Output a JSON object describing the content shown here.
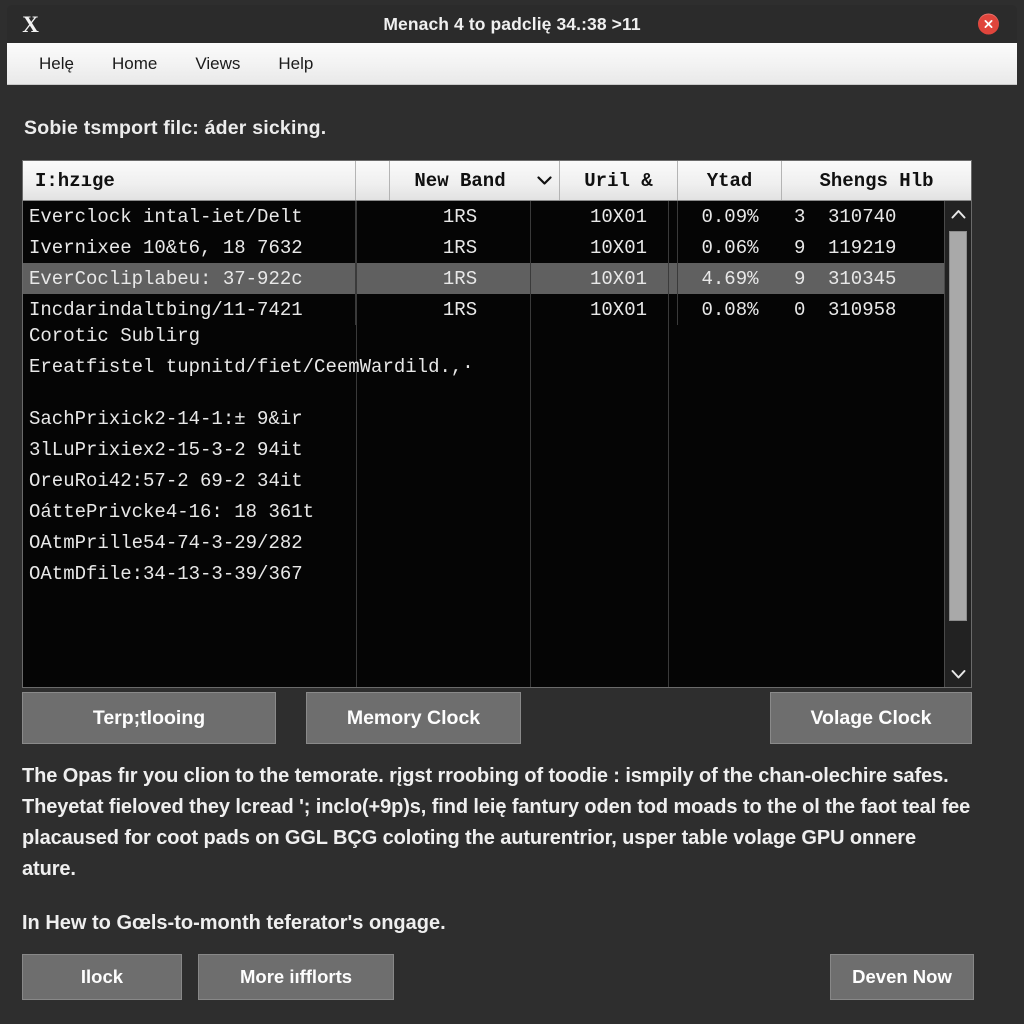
{
  "window": {
    "icon": "x-logo-icon",
    "title": "Menach 4 to padclię 34.:38 >11",
    "close_label": "close-icon"
  },
  "menubar": {
    "items": [
      {
        "label": "Helę"
      },
      {
        "label": "Home"
      },
      {
        "label": "Views"
      },
      {
        "label": "Help"
      }
    ]
  },
  "subtitle": "Sobie tsmport filc: áder sicking.",
  "table": {
    "headers": [
      {
        "label": "I:hzıge"
      },
      {
        "label": ""
      },
      {
        "label": "New Band"
      },
      {
        "label": "chevron-down-icon"
      },
      {
        "label": "Uril &"
      },
      {
        "label": "Ytad"
      },
      {
        "label": "Shengs Hlb"
      }
    ],
    "rows": [
      {
        "name": "Everclock intal-iet/Delt",
        "band": "1RS",
        "uril": "10X01",
        "ytad": "0.09%",
        "shengs_a": "3",
        "shengs_b": "310740",
        "selected": false
      },
      {
        "name": "Ivernixee 10&t6, 18 7632",
        "band": "1RS",
        "uril": "10X01",
        "ytad": "0.06%",
        "shengs_a": "9",
        "shengs_b": "119219",
        "selected": false
      },
      {
        "name": "EverCocliplabeu: 37-922c",
        "band": "1RS",
        "uril": "10X01",
        "ytad": "4.69%",
        "shengs_a": "9",
        "shengs_b": "310345",
        "selected": true
      },
      {
        "name": "Incdarindaltbing/11-7421",
        "band": "1RS",
        "uril": "10X01",
        "ytad": "0.08%",
        "shengs_a": "0",
        "shengs_b": "310958",
        "selected": false
      }
    ],
    "free_lines": [
      "Corotic Sublirg",
      "Ereatfistel tupnitd/fiet/CeemWardild.,·",
      "SachPrixick2-14-1:± 9&ir",
      "3lLuPrixiex2-15-3-2 94it",
      "OreuRoi42:57-2 69-2 34it",
      "OáttePrivcke4-16: 18 361t",
      "OAtmPrille54-74-3-29/282",
      "OAtmDfile:34-13-3-39/367"
    ]
  },
  "scrollbar": {
    "up": "scroll-up-icon",
    "down": "scroll-down-icon"
  },
  "mid_buttons": [
    {
      "label": "Terp;tlooing"
    },
    {
      "label": "Memory Clock"
    },
    {
      "label": "Volage Clock"
    }
  ],
  "paragraph": "The Opas fır you clion to the temorate. rįgst rroobing of toodie : ismpily of the chan-olechire safes.  Theyetat fieloved they lcread '; inclo(+9p)s, find leię fantury oden tod moads to the ol the faot teal fee placaused for coot pads on GGL BÇG coloting the auturentrior, usper table volage GPU onnere ature.",
  "note": "In Hew to Gœls-to-month teferator's ongage.",
  "footer_buttons": [
    {
      "label": "Ilock"
    },
    {
      "label": "More iıfflorts"
    },
    {
      "label": "Deven Now"
    }
  ],
  "colors": {
    "window_bg": "#2e2e2e",
    "titlebar_bg": "#2b2b2b",
    "menubar_bg": "#f2f2f2",
    "table_bg": "#050505",
    "header_bg": "#efefef",
    "selection": "#606060",
    "button_bg": "#6e6e6e",
    "close": "#e0453c",
    "text_light": "#efefef"
  }
}
